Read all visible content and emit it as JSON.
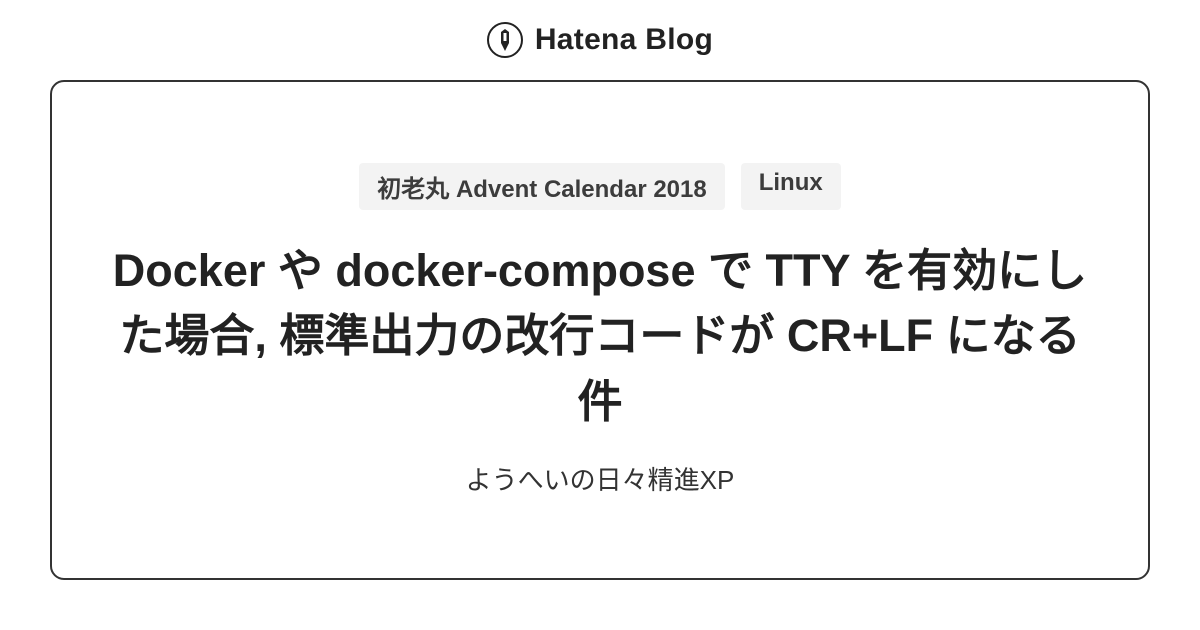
{
  "header": {
    "brand": "Hatena Blog"
  },
  "tags": [
    "初老丸 Advent Calendar 2018",
    "Linux"
  ],
  "title": "Docker や docker-compose で TTY を有効にした場合, 標準出力の改行コードが CR+LF になる件",
  "subtitle": "ようへいの日々精進XP"
}
